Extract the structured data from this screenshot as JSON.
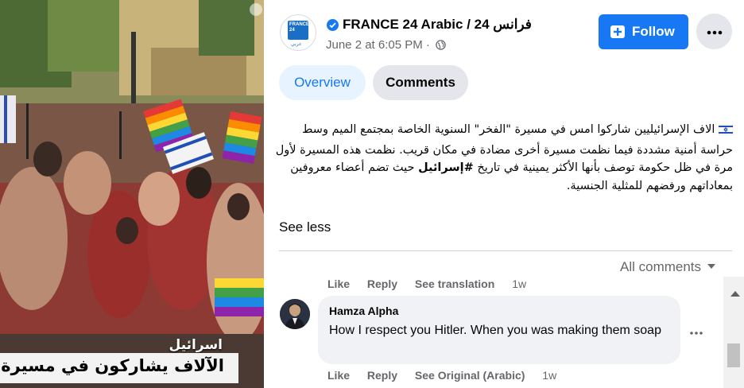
{
  "video": {
    "caption_country": "اسرائيل",
    "caption_headline": "الآلاف يشاركون في مسيرة \"الفخر\""
  },
  "header": {
    "page_name": "FRANCE 24 Arabic / فرانس 24",
    "time": "June 2 at 6:05 PM ·",
    "logo_text": "FRANCE 24",
    "logo_ar": "عربي"
  },
  "buttons": {
    "follow": "Follow",
    "more_icon": "ellipsis-icon"
  },
  "tabs": [
    {
      "label": "Overview",
      "active": true
    },
    {
      "label": "Comments",
      "active": false
    }
  ],
  "post": {
    "flag_icon": "israel-flag-icon",
    "text_before_hashtag": "الاف الإسرائيليين شاركوا امس في مسيرة \"الفخر\" السنوية الخاصة بمجتمع الميم وسط حراسة أمنية مشددة فيما نظمت مسيرة أخرى مضادة في مكان قريب. نظمت هذه المسيرة لأول مرة في ظل حكومة توصف بأنها الأكثر يمينية في تاريخ ",
    "hashtag": "#إسرائيل",
    "text_after_hashtag": " حيث تضم أعضاء معروفين بمعاداتهم ورفضهم للمثلية الجنسية.",
    "see_less": "See less"
  },
  "comments_filter": "All comments",
  "previous_actions": {
    "like": "Like",
    "reply": "Reply",
    "translation": "See translation",
    "time": "1w"
  },
  "comment": {
    "author": "Hamza Alpha",
    "text": "How I respect you Hitler. When you was making them soap",
    "like": "Like",
    "reply": "Reply",
    "see_original": "See Original (Arabic)",
    "time": "1w"
  },
  "colors": {
    "accent": "#1877f2",
    "tab_active_bg": "#e7f3ff",
    "bubble_bg": "#f0f2f5",
    "secondary_text": "#65676b"
  }
}
